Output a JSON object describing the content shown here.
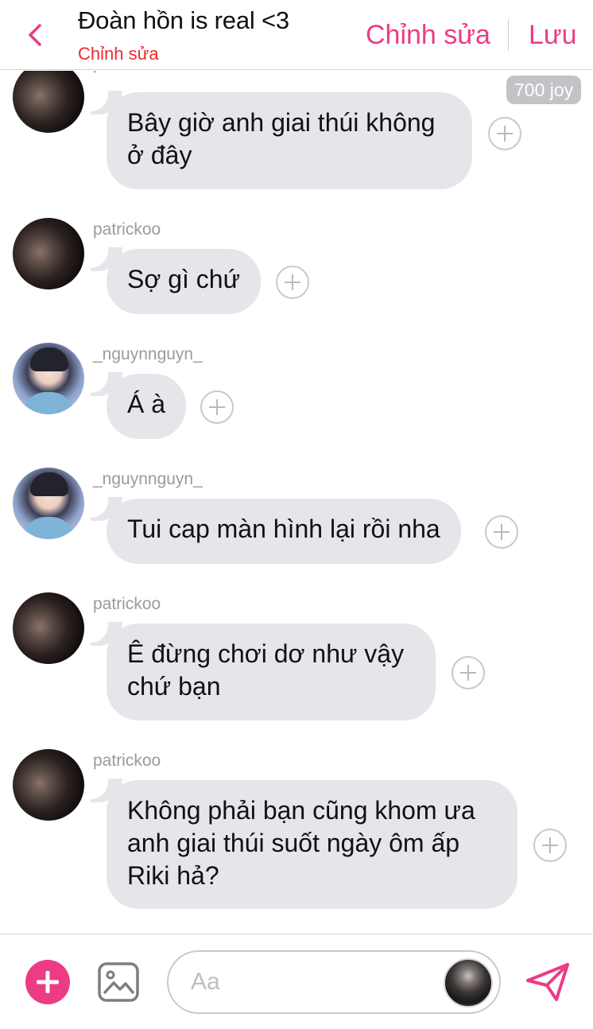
{
  "header": {
    "title": "Đoàn hồn is real <3",
    "subtitle": "Chỉnh sửa",
    "edit_label": "Chỉnh sửa",
    "save_label": "Lưu",
    "accent_color": "#ec3c86",
    "subtitle_color": "#ec2a2f"
  },
  "messages": [
    {
      "username": "patrickoo",
      "text": "Bây giờ anh giai thúi không ở đây",
      "badge": "700 joy",
      "avatar": "patrickoo-avatar"
    },
    {
      "username": "patrickoo",
      "text": "Sợ gì chứ",
      "avatar": "patrickoo-avatar"
    },
    {
      "username": "_nguynnguyn_",
      "text": "Á à",
      "avatar": "nguynnguyn-avatar"
    },
    {
      "username": "_nguynnguyn_",
      "text": "Tui cap màn hình lại rồi nha",
      "avatar": "nguynnguyn-avatar"
    },
    {
      "username": "patrickoo",
      "text": "Ê đừng chơi dơ như vậy chứ bạn",
      "avatar": "patrickoo-avatar"
    },
    {
      "username": "patrickoo",
      "text": "Không phải bạn cũng khom ưa anh giai thúi suốt ngày ôm ấp Riki hả?",
      "avatar": "patrickoo-avatar"
    }
  ],
  "composer": {
    "placeholder": "Aa",
    "icons": [
      "plus-icon",
      "image-icon",
      "send-icon"
    ]
  }
}
